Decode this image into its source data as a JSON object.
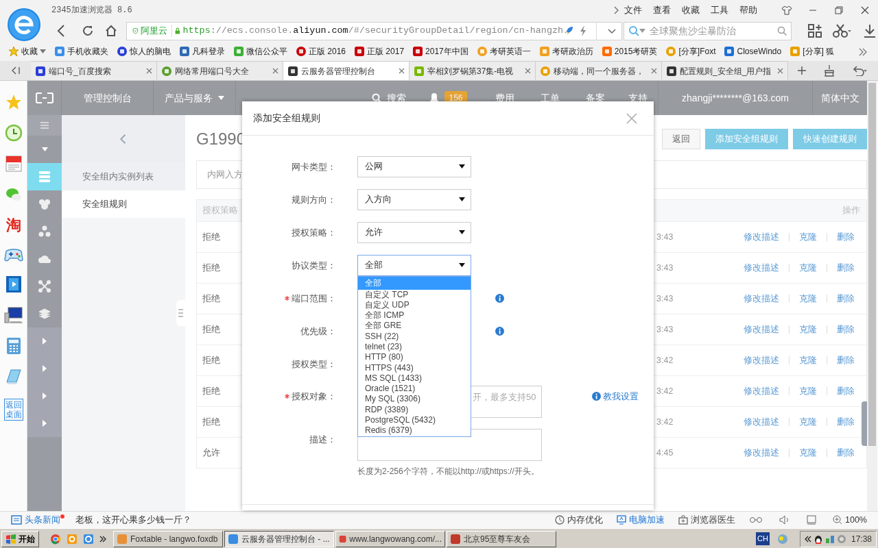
{
  "browser": {
    "title": "2345加速浏览器 8.6",
    "menu": [
      "文件",
      "查看",
      "收藏",
      "工具",
      "帮助"
    ],
    "address": {
      "badge": "阿里云",
      "parts": [
        {
          "text": "https",
          "kind": "secure"
        },
        {
          "text": "://ecs.console.",
          "kind": "dim"
        },
        {
          "text": "aliyun.com",
          "kind": "domain"
        },
        {
          "text": "/#/securityGroupDetail/region/cn-hangzh",
          "kind": "dim"
        }
      ]
    },
    "search": {
      "placeholder": "全球聚焦沙尘暴防治"
    },
    "favorites": "收藏",
    "bookmarks": [
      "手机收藏夹",
      "惊人的脑电",
      "凡科登录",
      "微信公众平",
      "正版 2016",
      "正版 2017",
      "2017年中国",
      "考研英语一",
      "考研政治历",
      "2015考研英",
      "[分享]Foxt",
      "CloseWindo",
      "[分享] 狐"
    ],
    "tabs": [
      {
        "title": "端口号_百度搜索",
        "selected": false
      },
      {
        "title": "网络常用端口号大全",
        "selected": false
      },
      {
        "title": "云服务器管理控制台",
        "selected": true
      },
      {
        "title": "宰相刘罗锅第37集-电视",
        "selected": false
      },
      {
        "title": "移动端，同一个服务器，",
        "selected": false
      },
      {
        "title": "配置规则_安全组_用户指",
        "selected": false
      }
    ],
    "sidebar": {
      "shop_icon_text": "淘",
      "desktop_button": "返回桌面"
    }
  },
  "console": {
    "nav": {
      "home": "管理控制台",
      "products": "产品与服务",
      "search": "搜索",
      "notifications": "156",
      "links": [
        "费用",
        "工单",
        "备案",
        "支持"
      ],
      "account": "zhangji********@163.com",
      "language": "简体中文"
    },
    "modules": [
      {
        "selected": true
      },
      {
        "selected": false
      },
      {
        "selected": false
      },
      {
        "selected": false
      },
      {
        "selected": false
      },
      {
        "selected": false
      }
    ],
    "submenu": [
      {
        "label": "安全组内实例列表",
        "selected": false
      },
      {
        "label": "安全组规则",
        "selected": true
      }
    ],
    "page": {
      "title": "G1990",
      "buttons": [
        {
          "label": "返回",
          "kind": "default"
        },
        {
          "label": "添加安全组规则",
          "kind": "primary"
        },
        {
          "label": "快速创建规则",
          "kind": "primary"
        }
      ],
      "tab": "内网入方",
      "columns": [
        "授权策略",
        "操作"
      ],
      "rows": [
        {
          "policy": "拒绝",
          "time": "3:43",
          "actions": [
            "修改描述",
            "克隆",
            "删除"
          ]
        },
        {
          "policy": "拒绝",
          "time": "3:43",
          "actions": [
            "修改描述",
            "克隆",
            "删除"
          ]
        },
        {
          "policy": "拒绝",
          "time": "3:43",
          "actions": [
            "修改描述",
            "克隆",
            "删除"
          ]
        },
        {
          "policy": "拒绝",
          "time": "3:43",
          "actions": [
            "修改描述",
            "克隆",
            "删除"
          ]
        },
        {
          "policy": "拒绝",
          "time": "3:42",
          "actions": [
            "修改描述",
            "克隆",
            "删除"
          ]
        },
        {
          "policy": "拒绝",
          "time": "3:42",
          "actions": [
            "修改描述",
            "克隆",
            "删除"
          ]
        },
        {
          "policy": "拒绝",
          "time": "3:42",
          "actions": [
            "修改描述",
            "克隆",
            "删除"
          ]
        },
        {
          "policy": "允许",
          "time": "4:45",
          "actions": [
            "修改描述",
            "克隆",
            "删除"
          ]
        }
      ]
    }
  },
  "dialog": {
    "title": "添加安全组规则",
    "fields": [
      {
        "label": "网卡类型：",
        "kind": "select",
        "value": "公网",
        "required": false,
        "expanded": false,
        "info": false
      },
      {
        "label": "规则方向：",
        "kind": "select",
        "value": "入方向",
        "required": false,
        "expanded": false,
        "info": false
      },
      {
        "label": "授权策略：",
        "kind": "select",
        "value": "允许",
        "required": false,
        "expanded": false,
        "info": false
      },
      {
        "label": "协议类型：",
        "kind": "select",
        "value": "全部",
        "required": false,
        "expanded": true,
        "info": false
      },
      {
        "label": "端口范围：",
        "kind": "covered",
        "required": true,
        "info": true
      },
      {
        "label": "优先级：",
        "kind": "covered",
        "required": false,
        "info": true
      },
      {
        "label": "授权类型：",
        "kind": "covered",
        "required": false,
        "info": false
      },
      {
        "label": "授权对象：",
        "kind": "textarea",
        "placeholder": "开，最多支持50",
        "help": "教我设置",
        "required": true,
        "info": false
      },
      {
        "label": "描述：",
        "kind": "textarea",
        "hint": "长度为2-256个字符，不能以http://或https://开头。",
        "required": false,
        "info": false
      }
    ],
    "options": [
      {
        "label": "全部",
        "selected": true
      },
      {
        "label": "自定义 TCP",
        "selected": false
      },
      {
        "label": "自定义 UDP",
        "selected": false
      },
      {
        "label": "全部 ICMP",
        "selected": false
      },
      {
        "label": "全部 GRE",
        "selected": false
      },
      {
        "label": "SSH (22)",
        "selected": false
      },
      {
        "label": "telnet (23)",
        "selected": false
      },
      {
        "label": "HTTP (80)",
        "selected": false
      },
      {
        "label": "HTTPS (443)",
        "selected": false
      },
      {
        "label": "MS SQL (1433)",
        "selected": false
      },
      {
        "label": "Oracle (1521)",
        "selected": false
      },
      {
        "label": "My SQL (3306)",
        "selected": false
      },
      {
        "label": "RDP (3389)",
        "selected": false
      },
      {
        "label": "PostgreSQL (5432)",
        "selected": false
      },
      {
        "label": "Redis (6379)",
        "selected": false
      }
    ]
  },
  "status_bar": {
    "news_label": "头条新闻",
    "news_unread": true,
    "headline": "老板，这开心果多少钱一斤？",
    "tools": [
      {
        "label": "内存优化",
        "active": false
      },
      {
        "label": "电脑加速",
        "active": true
      },
      {
        "label": "浏览器医生",
        "active": false
      }
    ],
    "zoom": "100%"
  },
  "taskbar": {
    "start": "开始",
    "tasks": [
      {
        "label": "Foxtable - langwo.foxdb",
        "selected": false
      },
      {
        "label": "云服务器管理控制台 - ...",
        "selected": true
      },
      {
        "label": "www.langwowang.com/...",
        "selected": false
      },
      {
        "label": "北京95至尊车友会",
        "selected": false
      }
    ],
    "ime": "CH",
    "clock": "17:38"
  }
}
